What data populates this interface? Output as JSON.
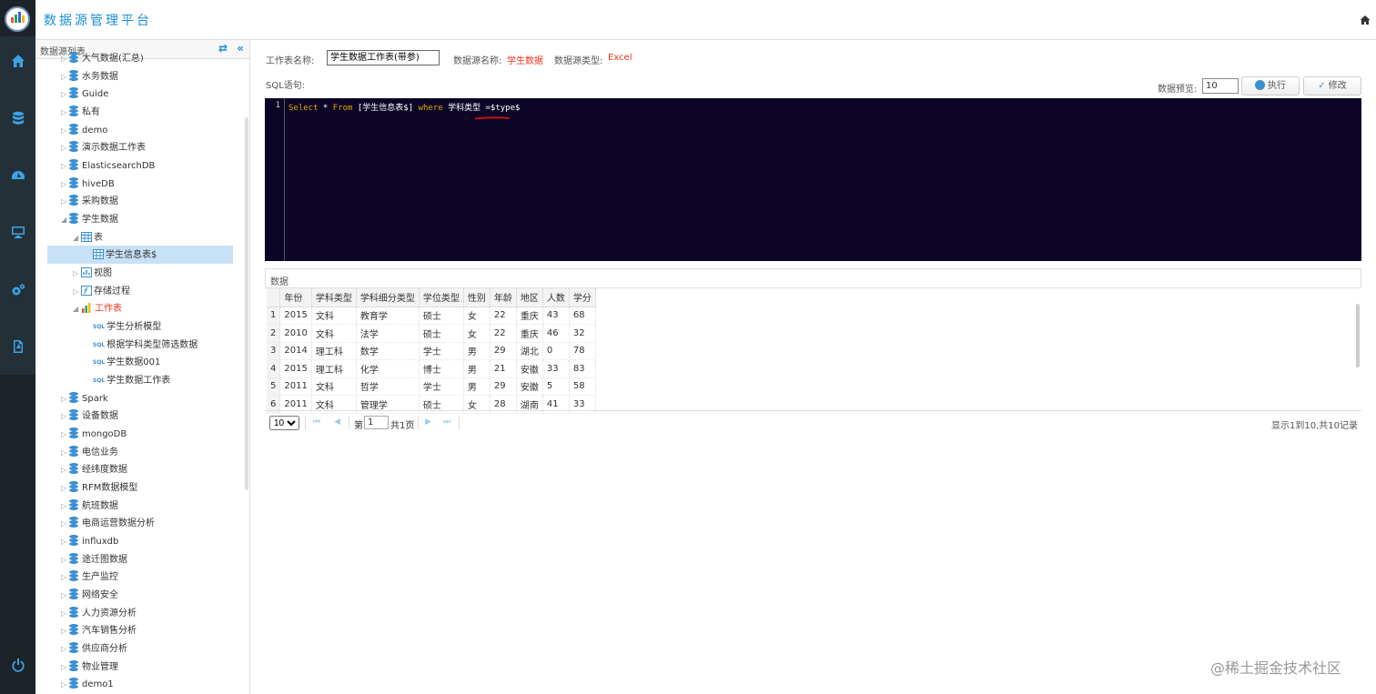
{
  "app": {
    "title": "数据源管理平台"
  },
  "rail": {
    "icons": [
      "home-icon",
      "database-icon",
      "dashboard-icon",
      "monitor-icon",
      "settings-icon",
      "pdf-icon",
      "power-icon"
    ],
    "accent": "#3ba4e6"
  },
  "sidebar": {
    "title": "数据源列表",
    "refresh_icon": "⇄",
    "collapse_icon": "«",
    "nodes": [
      {
        "label": "大气数据(汇总)",
        "level": 0,
        "type": "db",
        "toggle": "▷"
      },
      {
        "label": "水务数据",
        "level": 0,
        "type": "db",
        "toggle": "▷"
      },
      {
        "label": "Guide",
        "level": 0,
        "type": "db",
        "toggle": "▷"
      },
      {
        "label": "私有",
        "level": 0,
        "type": "db",
        "toggle": "▷"
      },
      {
        "label": "demo",
        "level": 0,
        "type": "db",
        "toggle": "▷"
      },
      {
        "label": "演示数据工作表",
        "level": 0,
        "type": "db",
        "toggle": "▷"
      },
      {
        "label": "ElasticsearchDB",
        "level": 0,
        "type": "db",
        "toggle": "▷"
      },
      {
        "label": "hiveDB",
        "level": 0,
        "type": "db",
        "toggle": "▷"
      },
      {
        "label": "采购数据",
        "level": 0,
        "type": "db",
        "toggle": "▷"
      },
      {
        "label": "学生数据",
        "level": 0,
        "type": "db",
        "toggle": "◢"
      },
      {
        "label": "表",
        "level": 1,
        "type": "table",
        "toggle": "◢"
      },
      {
        "label": "学生信息表$",
        "level": 2,
        "type": "table",
        "toggle": ""
      },
      {
        "label": "视图",
        "level": 1,
        "type": "view",
        "toggle": "▷"
      },
      {
        "label": "存储过程",
        "level": 1,
        "type": "proc",
        "toggle": "▷"
      },
      {
        "label": "工作表",
        "level": 1,
        "type": "chart",
        "toggle": "◢"
      },
      {
        "label": "学生分析模型",
        "level": 2,
        "type": "sql",
        "toggle": ""
      },
      {
        "label": "根据学科类型筛选数据",
        "level": 2,
        "type": "sql",
        "toggle": ""
      },
      {
        "label": "学生数据001",
        "level": 2,
        "type": "sql",
        "toggle": ""
      },
      {
        "label": "学生数据工作表",
        "level": 2,
        "type": "sql",
        "toggle": ""
      },
      {
        "label": "Spark",
        "level": 0,
        "type": "db",
        "toggle": "▷"
      },
      {
        "label": "设备数据",
        "level": 0,
        "type": "db",
        "toggle": "▷"
      },
      {
        "label": "mongoDB",
        "level": 0,
        "type": "db",
        "toggle": "▷"
      },
      {
        "label": "电信业务",
        "level": 0,
        "type": "db",
        "toggle": "▷"
      },
      {
        "label": "经纬度数据",
        "level": 0,
        "type": "db",
        "toggle": "▷"
      },
      {
        "label": "RFM数据模型",
        "level": 0,
        "type": "db",
        "toggle": "▷"
      },
      {
        "label": "航班数据",
        "level": 0,
        "type": "db",
        "toggle": "▷"
      },
      {
        "label": "电商运营数据分析",
        "level": 0,
        "type": "db",
        "toggle": "▷"
      },
      {
        "label": "influxdb",
        "level": 0,
        "type": "db",
        "toggle": "▷"
      },
      {
        "label": "途迁图数据",
        "level": 0,
        "type": "db",
        "toggle": "▷"
      },
      {
        "label": "生产监控",
        "level": 0,
        "type": "db",
        "toggle": "▷"
      },
      {
        "label": "网络安全",
        "level": 0,
        "type": "db",
        "toggle": "▷"
      },
      {
        "label": "人力资源分析",
        "level": 0,
        "type": "db",
        "toggle": "▷"
      },
      {
        "label": "汽车销售分析",
        "level": 0,
        "type": "db",
        "toggle": "▷"
      },
      {
        "label": "供应商分析",
        "level": 0,
        "type": "db",
        "toggle": "▷"
      },
      {
        "label": "物业管理",
        "level": 0,
        "type": "db",
        "toggle": "▷"
      },
      {
        "label": "demo1",
        "level": 0,
        "type": "db",
        "toggle": "▷"
      }
    ]
  },
  "form": {
    "sheet_name_label": "工作表名称:",
    "sheet_name_value": "学生数据工作表(带参)",
    "source_name_label": "数据源名称:",
    "source_name_value": "学生数据",
    "source_type_label": "数据源类型:",
    "source_type_value": "Excel",
    "sql_label": "SQL语句:",
    "preview_label": "数据预览:",
    "preview_value": "10",
    "run_label": "执行",
    "edit_label": "修改"
  },
  "editor": {
    "line_number": "1",
    "kw_select": "Select",
    "star": " * ",
    "kw_from": "From",
    "table": " [学生信息表$] ",
    "kw_where": "where",
    "column": " 学科类型 ",
    "param": "=$type$"
  },
  "data_panel": {
    "title": "数据"
  },
  "table": {
    "headers": [
      "",
      "年份",
      "学科类型",
      "学科细分类型",
      "学位类型",
      "性别",
      "年龄",
      "地区",
      "人数",
      "学分"
    ],
    "rows": [
      [
        "1",
        "2015",
        "文科",
        "教育学",
        "硕士",
        "女",
        "22",
        "重庆",
        "43",
        "68"
      ],
      [
        "2",
        "2010",
        "文科",
        "法学",
        "硕士",
        "女",
        "22",
        "重庆",
        "46",
        "32"
      ],
      [
        "3",
        "2014",
        "理工科",
        "数学",
        "学士",
        "男",
        "29",
        "湖北",
        "0",
        "78"
      ],
      [
        "4",
        "2015",
        "理工科",
        "化学",
        "博士",
        "男",
        "21",
        "安徽",
        "33",
        "83"
      ],
      [
        "5",
        "2011",
        "文科",
        "哲学",
        "学士",
        "男",
        "29",
        "安徽",
        "5",
        "58"
      ],
      [
        "6",
        "2011",
        "文科",
        "管理学",
        "硕士",
        "女",
        "28",
        "湖南",
        "41",
        "33"
      ]
    ]
  },
  "pager": {
    "page_size": "10",
    "page_prefix": "第",
    "page_value": "1",
    "page_suffix": "共1页",
    "record_info": "显示1到10,共10记录"
  },
  "watermark": "@稀土掘金技术社区",
  "colors": {
    "accent": "#1a8fd8",
    "danger": "#e32222",
    "editor_bg": "#0c0526"
  }
}
